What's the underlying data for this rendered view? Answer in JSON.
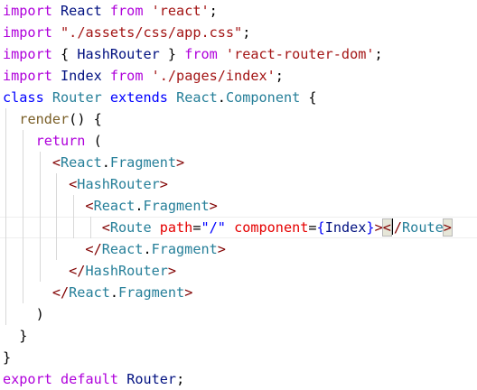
{
  "colors": {
    "keyword": "#af00db",
    "control": "#af00db",
    "declaration": "#0000ff",
    "string": "#a31515",
    "identifier": "#001080",
    "type": "#267f99",
    "function": "#795e26",
    "tag": "#800000",
    "attribute": "#e50000",
    "plain": "#000000"
  },
  "lines": [
    [
      {
        "t": "import",
        "c": "keyword"
      },
      {
        "t": " React ",
        "c": "identifier"
      },
      {
        "t": "from",
        "c": "keyword"
      },
      {
        "t": " ",
        "c": "plain"
      },
      {
        "t": "'react'",
        "c": "string"
      },
      {
        "t": ";",
        "c": "plain"
      }
    ],
    [
      {
        "t": "import",
        "c": "keyword"
      },
      {
        "t": " ",
        "c": "plain"
      },
      {
        "t": "\"./assets/css/app.css\"",
        "c": "string"
      },
      {
        "t": ";",
        "c": "plain"
      }
    ],
    [
      {
        "t": "import",
        "c": "keyword"
      },
      {
        "t": " { ",
        "c": "plain"
      },
      {
        "t": "HashRouter",
        "c": "identifier"
      },
      {
        "t": " } ",
        "c": "plain"
      },
      {
        "t": "from",
        "c": "keyword"
      },
      {
        "t": " ",
        "c": "plain"
      },
      {
        "t": "'react-router-dom'",
        "c": "string"
      },
      {
        "t": ";",
        "c": "plain"
      }
    ],
    [
      {
        "t": "import",
        "c": "keyword"
      },
      {
        "t": " Index ",
        "c": "identifier"
      },
      {
        "t": "from",
        "c": "keyword"
      },
      {
        "t": " ",
        "c": "plain"
      },
      {
        "t": "'./pages/index'",
        "c": "string"
      },
      {
        "t": ";",
        "c": "plain"
      }
    ],
    [
      {
        "t": "class",
        "c": "declaration"
      },
      {
        "t": " ",
        "c": "plain"
      },
      {
        "t": "Router",
        "c": "type"
      },
      {
        "t": " ",
        "c": "plain"
      },
      {
        "t": "extends",
        "c": "declaration"
      },
      {
        "t": " ",
        "c": "plain"
      },
      {
        "t": "React",
        "c": "type"
      },
      {
        "t": ".",
        "c": "plain"
      },
      {
        "t": "Component",
        "c": "type"
      },
      {
        "t": " {",
        "c": "plain"
      }
    ],
    [
      {
        "t": "  ",
        "c": "plain"
      },
      {
        "t": "render",
        "c": "function"
      },
      {
        "t": "() {",
        "c": "plain"
      }
    ],
    [
      {
        "t": "    ",
        "c": "plain"
      },
      {
        "t": "return",
        "c": "control"
      },
      {
        "t": " (",
        "c": "plain"
      }
    ],
    [
      {
        "t": "      <",
        "c": "tag"
      },
      {
        "t": "React",
        "c": "type"
      },
      {
        "t": ".",
        "c": "plain"
      },
      {
        "t": "Fragment",
        "c": "type"
      },
      {
        "t": ">",
        "c": "tag"
      }
    ],
    [
      {
        "t": "        <",
        "c": "tag"
      },
      {
        "t": "HashRouter",
        "c": "type"
      },
      {
        "t": ">",
        "c": "tag"
      }
    ],
    [
      {
        "t": "          <",
        "c": "tag"
      },
      {
        "t": "React",
        "c": "type"
      },
      {
        "t": ".",
        "c": "plain"
      },
      {
        "t": "Fragment",
        "c": "type"
      },
      {
        "t": ">",
        "c": "tag"
      }
    ],
    [
      {
        "t": "            <",
        "c": "tag"
      },
      {
        "t": "Route",
        "c": "type"
      },
      {
        "t": " ",
        "c": "plain"
      },
      {
        "t": "path",
        "c": "attribute"
      },
      {
        "t": "=",
        "c": "plain"
      },
      {
        "t": "\"/\"",
        "c": "declaration"
      },
      {
        "t": " ",
        "c": "plain"
      },
      {
        "t": "component",
        "c": "attribute"
      },
      {
        "t": "=",
        "c": "plain"
      },
      {
        "t": "{",
        "c": "declaration"
      },
      {
        "t": "Index",
        "c": "identifier"
      },
      {
        "t": "}",
        "c": "declaration"
      },
      {
        "t": ">",
        "c": "tag"
      },
      {
        "t": "<",
        "c": "bracket"
      },
      {
        "t": "CARET",
        "c": "caret"
      },
      {
        "t": "/",
        "c": "tag"
      },
      {
        "t": "Route",
        "c": "type"
      },
      {
        "t": ">",
        "c": "bracket"
      }
    ],
    [
      {
        "t": "          </",
        "c": "tag"
      },
      {
        "t": "React",
        "c": "type"
      },
      {
        "t": ".",
        "c": "plain"
      },
      {
        "t": "Fragment",
        "c": "type"
      },
      {
        "t": ">",
        "c": "tag"
      }
    ],
    [
      {
        "t": "        </",
        "c": "tag"
      },
      {
        "t": "HashRouter",
        "c": "type"
      },
      {
        "t": ">",
        "c": "tag"
      }
    ],
    [
      {
        "t": "      </",
        "c": "tag"
      },
      {
        "t": "React",
        "c": "type"
      },
      {
        "t": ".",
        "c": "plain"
      },
      {
        "t": "Fragment",
        "c": "type"
      },
      {
        "t": ">",
        "c": "tag"
      }
    ],
    [
      {
        "t": "    )",
        "c": "plain"
      }
    ],
    [
      {
        "t": "  }",
        "c": "plain"
      }
    ],
    [
      {
        "t": "}",
        "c": "plain"
      }
    ],
    [
      {
        "t": "export",
        "c": "keyword"
      },
      {
        "t": " ",
        "c": "plain"
      },
      {
        "t": "default",
        "c": "keyword"
      },
      {
        "t": " Router",
        "c": "identifier"
      },
      {
        "t": ";",
        "c": "plain"
      }
    ]
  ]
}
